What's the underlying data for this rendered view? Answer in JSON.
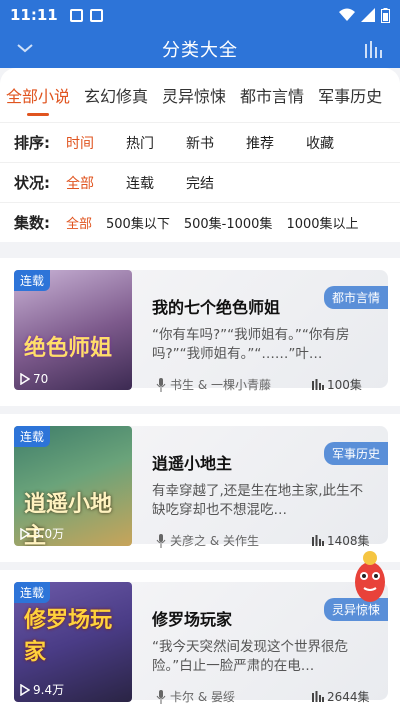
{
  "status": {
    "time": "11:11"
  },
  "header": {
    "title": "分类大全",
    "back_icon": "chevron-down-icon",
    "chart_icon": "bar-chart-icon"
  },
  "categories": [
    {
      "label": "全部小说",
      "active": true
    },
    {
      "label": "玄幻修真"
    },
    {
      "label": "灵异惊悚"
    },
    {
      "label": "都市言情"
    },
    {
      "label": "军事历史"
    }
  ],
  "filters": {
    "sort": {
      "label": "排序:",
      "options": [
        "时间",
        "热门",
        "新书",
        "推荐",
        "收藏"
      ],
      "selected": 0
    },
    "status": {
      "label": "状况:",
      "options": [
        "全部",
        "连载",
        "完结"
      ],
      "selected": 0
    },
    "episodes": {
      "label": "集数:",
      "options": [
        "全部",
        "500集以下",
        "500集-1000集",
        "1000集以上"
      ],
      "selected": 0
    }
  },
  "colors": {
    "accent": "#e0541f",
    "brand": "#2d74d8"
  },
  "books": [
    {
      "badge": "连载",
      "cover_text": "绝色师姐",
      "plays": "70",
      "genre": "都市言情",
      "title": "我的七个绝色师姐",
      "desc": "“你有车吗?”“我师姐有。”“你有房吗?”“我师姐有。”“……”叶…",
      "author": "书生 & 一棵小青藤",
      "episodes": "100集"
    },
    {
      "badge": "连载",
      "cover_text": "逍遥小地主",
      "plays": "3.0万",
      "genre": "军事历史",
      "title": "逍遥小地主",
      "desc": "有幸穿越了,还是生在地主家,此生不缺吃穿却也不想混吃…",
      "author": "关彦之 & 关作生",
      "episodes": "1408集"
    },
    {
      "badge": "连载",
      "cover_text": "修罗场玩家",
      "plays": "9.4万",
      "genre": "灵异惊悚",
      "title": "修罗场玩家",
      "desc": "“我今天突然间发现这个世界很危险。”白止一脸严肃的在电…",
      "author": "卡尔 & 晏绥",
      "episodes": "2644集"
    }
  ]
}
